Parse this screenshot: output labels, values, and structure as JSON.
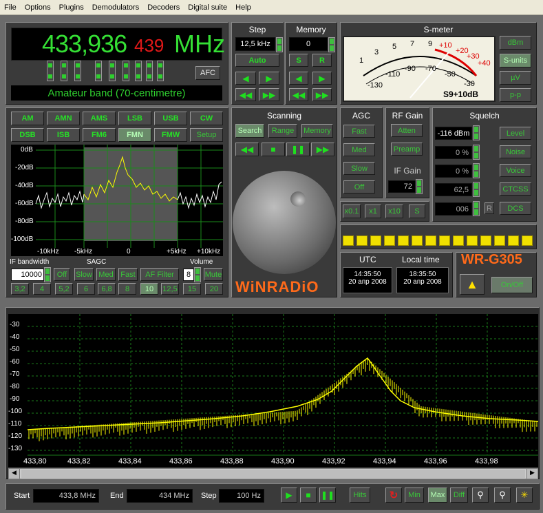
{
  "menu": [
    "File",
    "Options",
    "Plugins",
    "Demodulators",
    "Decoders",
    "Digital suite",
    "Help"
  ],
  "freq": {
    "main": "433,936",
    "sub": "439",
    "unit": "MHz",
    "afc": "AFC",
    "band": "Amateur band (70-centimetre)"
  },
  "step": {
    "title": "Step",
    "value": "12,5 kHz",
    "auto": "Auto"
  },
  "memory": {
    "title": "Memory",
    "value": "0",
    "s": "S",
    "r": "R"
  },
  "smeter": {
    "title": "S-meter",
    "scale_top": [
      "1",
      "3",
      "5",
      "7",
      "9",
      "+10",
      "+20",
      "+30",
      "+40"
    ],
    "scale_bottom": [
      "-130",
      "-110",
      "-90",
      "-70",
      "-50",
      "-30"
    ],
    "reading": "S9+10dB",
    "buttons": [
      "dBm",
      "S-units",
      "µV",
      "p-p"
    ]
  },
  "modes": [
    "AM",
    "AMN",
    "AMS",
    "LSB",
    "USB",
    "CW",
    "DSB",
    "ISB",
    "FM6",
    "FMN",
    "FMW",
    "Setup"
  ],
  "spectrum": {
    "ylabels": [
      "0dB",
      "-20dB",
      "-40dB",
      "-60dB",
      "-80dB",
      "-100dB"
    ],
    "xlabels": [
      "-10kHz",
      "-5kHz",
      "0",
      "+5kHz",
      "+10kHz"
    ]
  },
  "ifbw": {
    "label": "IF bandwidth",
    "value": "10000",
    "off": "Off"
  },
  "sagc": {
    "label": "SAGC",
    "slow": "Slow",
    "med": "Med",
    "fast": "Fast",
    "af": "AF Filter"
  },
  "volume": {
    "label": "Volume",
    "value": "8",
    "mute": "Mute"
  },
  "bwpresets": [
    "3,2",
    "4",
    "5,2",
    "6",
    "6,8",
    "8",
    "10",
    "12,5",
    "15",
    "20"
  ],
  "scanning": {
    "title": "Scanning",
    "search": "Search",
    "range": "Range",
    "memory": "Memory"
  },
  "agc": {
    "title": "AGC",
    "fast": "Fast",
    "med": "Med",
    "slow": "Slow",
    "off": "Off"
  },
  "rfgain": {
    "title": "RF Gain",
    "atten": "Atten",
    "preamp": "Preamp"
  },
  "ifgain": {
    "title": "IF Gain",
    "value": "72"
  },
  "mult": [
    "x0.1",
    "x1",
    "x10",
    "S"
  ],
  "squelch": {
    "title": "Squelch",
    "level": "-116 dBm",
    "v2": "0 %",
    "v3": "0 %",
    "v4": "62,5",
    "v5": "006",
    "r": "R",
    "btns": [
      "Level",
      "Noise",
      "Voice",
      "CTCSS",
      "DCS"
    ]
  },
  "utc": {
    "label": "UTC",
    "time": "14:35:50",
    "date": "20 апр 2008"
  },
  "local": {
    "label": "Local time",
    "time": "18:35:50",
    "date": "20 апр 2008"
  },
  "brand": {
    "winradio": "WiNRADiO",
    "model": "WR-G305",
    "onoff": "On/Off"
  },
  "bigspec": {
    "ylabels": [
      "-30",
      "-40",
      "-50",
      "-60",
      "-70",
      "-80",
      "-90",
      "-100",
      "-110",
      "-120",
      "-130"
    ],
    "xlabels": [
      "433,80",
      "433,82",
      "433,84",
      "433,86",
      "433,88",
      "433,90",
      "433,92",
      "433,94",
      "433,96",
      "433,98"
    ]
  },
  "bottom": {
    "start_label": "Start",
    "start": "433,8 MHz",
    "end_label": "End",
    "end": "434 MHz",
    "step_label": "Step",
    "step": "100 Hz",
    "hits": "Hits",
    "min": "Min",
    "max": "Max",
    "diff": "Diff"
  },
  "colors": {
    "accent": "#27e027",
    "trace": "#ffff00",
    "bg": "#3a3a3a"
  }
}
